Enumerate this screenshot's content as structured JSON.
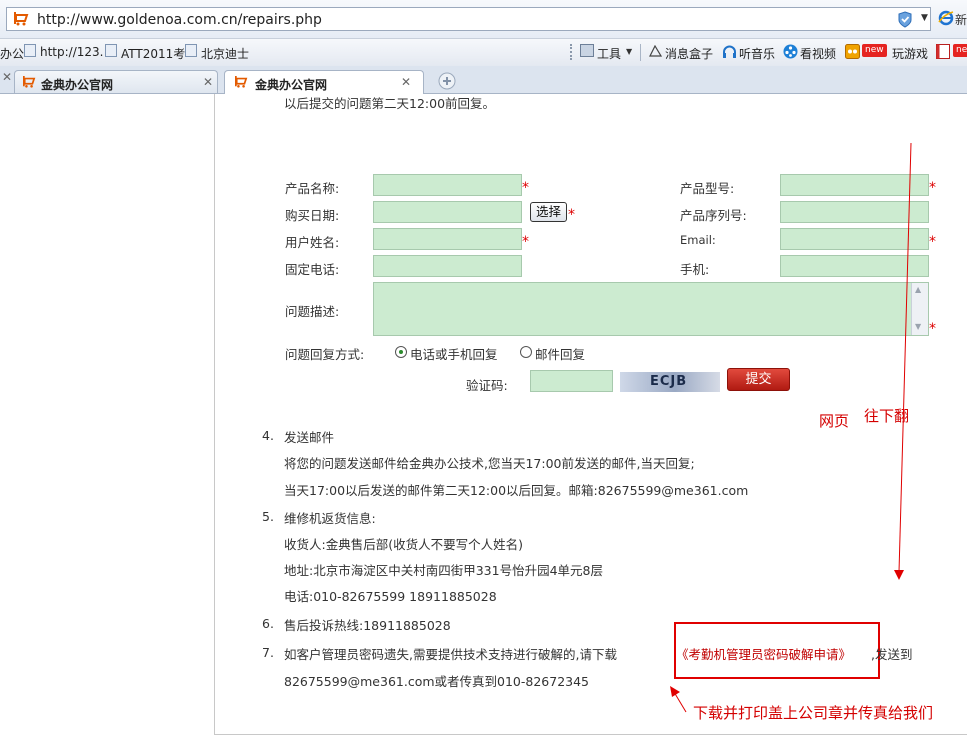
{
  "browser": {
    "url": "http://www.goldenoa.com.cn/repairs.php",
    "right_cut": "新",
    "favorites": [
      "办公",
      "http://123.",
      "ATT2011考",
      "北京迪士"
    ],
    "toolbar": {
      "tools": "工具",
      "news": "消息盒子",
      "music": "听音乐",
      "video": "看视频",
      "new_badge": "new",
      "games": "玩游戏",
      "new_badge2": "new"
    },
    "tabs": [
      {
        "label": "金典办公官网",
        "active": false
      },
      {
        "label": "金典办公官网",
        "active": true
      }
    ]
  },
  "page": {
    "top_line": "以后提交的问题第二天12:00前回复。",
    "form": {
      "product_name": "产品名称:",
      "product_model": "产品型号:",
      "purchase_date": "购买日期:",
      "select_button": "选择",
      "serial": "产品序列号:",
      "user_name": "用户姓名:",
      "email": "Email:",
      "phone": "固定电话:",
      "mobile": "手机:",
      "problem": "问题描述:",
      "reply_method": "问题回复方式:",
      "option_phone": "电话或手机回复",
      "option_email": "邮件回复",
      "captcha_label": "验证码:",
      "captcha_text": "ECJB",
      "submit": "提交",
      "required_mark": "*"
    },
    "items": [
      {
        "num": "4.",
        "lines": [
          "发送邮件",
          "将您的问题发送邮件给金典办公技术,您当天17:00前发送的邮件,当天回复;",
          "当天17:00以后发送的邮件第二天12:00以后回复。邮箱:82675599@me361.com"
        ]
      },
      {
        "num": "5.",
        "lines": [
          "维修机返货信息:",
          "收货人:金典售后部(收货人不要写个人姓名)",
          "地址:北京市海淀区中关村南四街甲331号怡升园4单元8层",
          "电话:010-82675599 18911885028"
        ]
      },
      {
        "num": "6.",
        "lines": [
          "售后投诉热线:18911885028"
        ]
      },
      {
        "num": "7.",
        "text_before": "如客户管理员密码遗失,需要提供技术支持进行破解的,请下载",
        "link": "《考勤机管理员密码破解申请》",
        "text_after": ",发送到",
        "line2": "82675599@me361.com或者传真到010-82672345"
      }
    ],
    "annotations": {
      "scroll_note_a": "网页",
      "scroll_note_b": "往下翻",
      "download_note": "下载并打印盖上公司章并传真给我们"
    }
  }
}
